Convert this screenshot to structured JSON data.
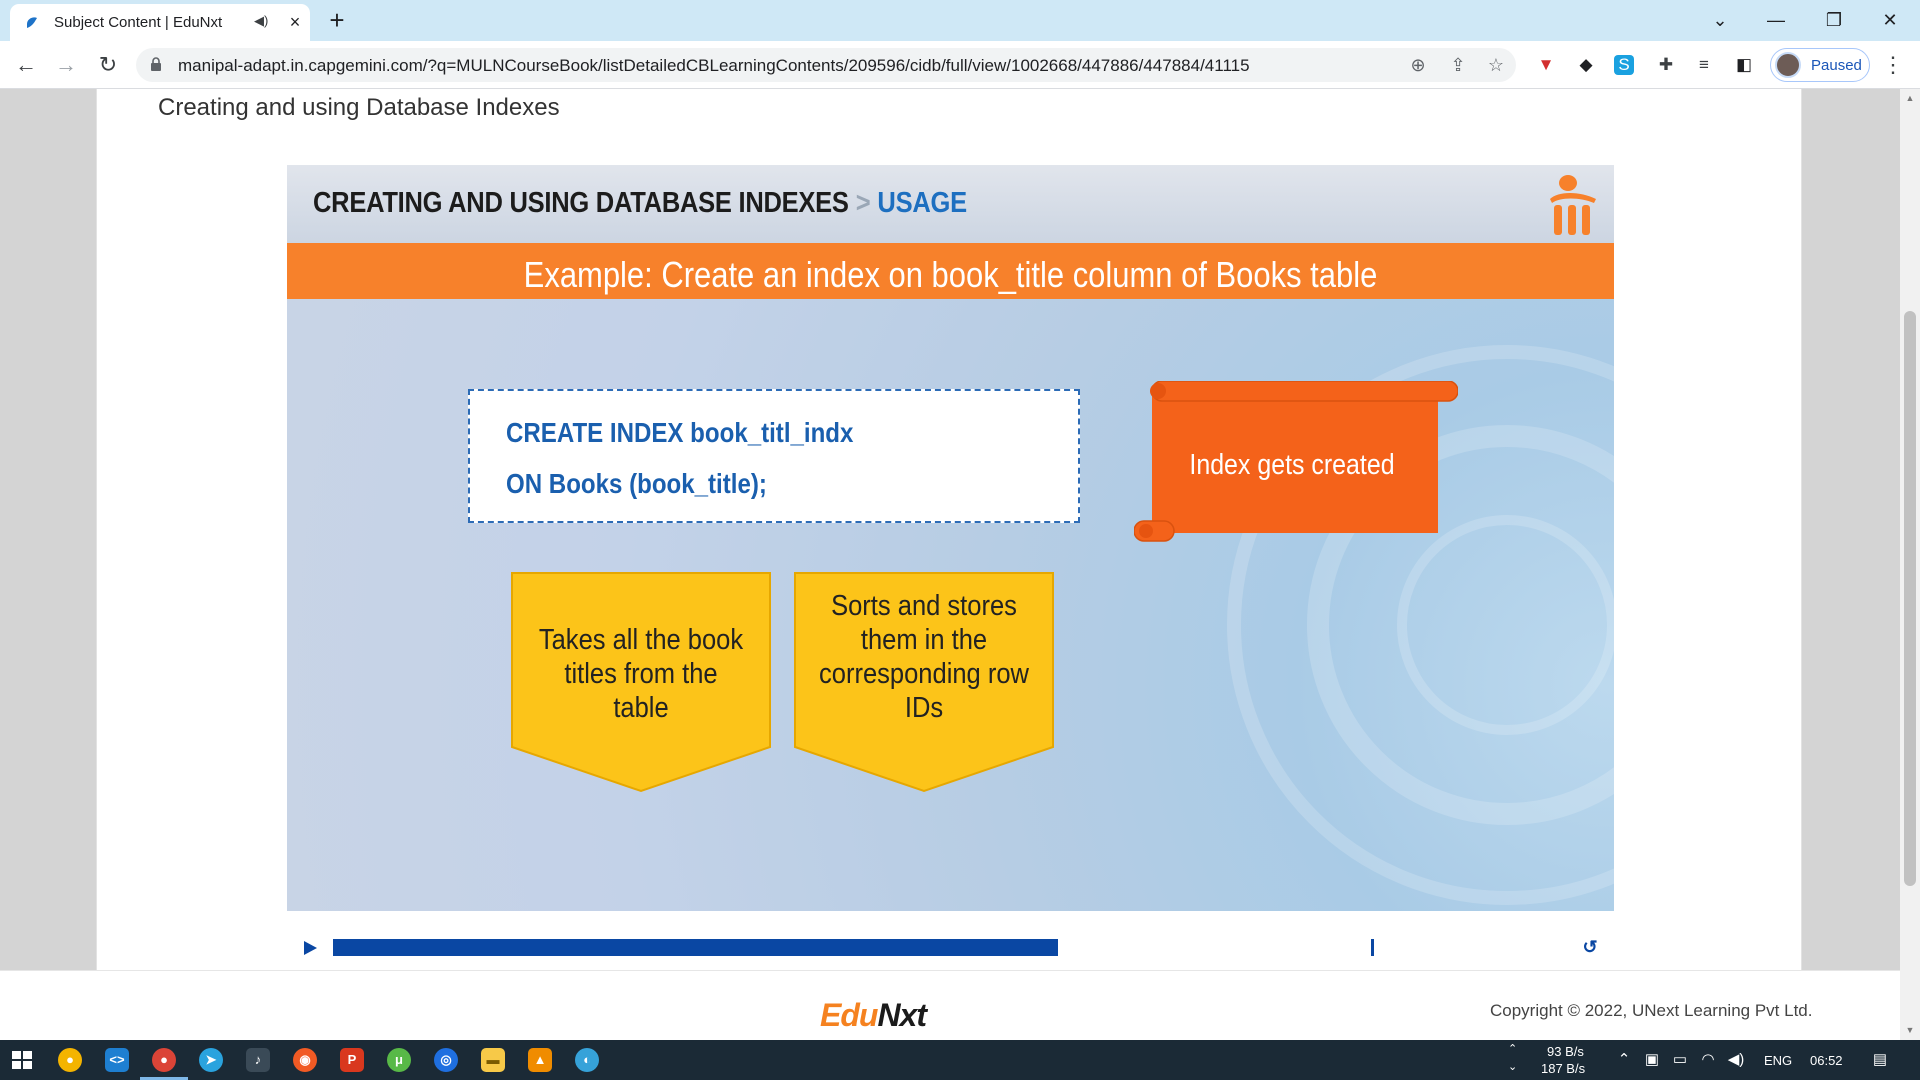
{
  "browser": {
    "tab_title": "Subject Content | EduNxt",
    "new_tab": "+",
    "url": "manipal-adapt.in.capgemini.com/?q=MULNCourseBook/listDetailedCBLearningContents/209596/cidb/full/view/1002668/447886/447884/41115",
    "profile_status": "Paused",
    "window_controls": {
      "tab_search": "⌄",
      "minimize": "—",
      "restore": "❐",
      "close": "✕"
    }
  },
  "content": {
    "title": "Creating and using Database Indexes"
  },
  "slide": {
    "heading_main": "CREATING AND USING DATABASE INDEXES",
    "heading_sep": ">",
    "heading_sub": "USAGE",
    "banner": "Example: Create an index on book_title column of Books table",
    "code_line_1": "CREATE INDEX book_titl_indx",
    "code_line_2": "ON Books (book_title);",
    "result_label": "Index gets created",
    "step_1": "Takes all the book titles from the table",
    "step_2": "Sorts and stores them in  the corresponding row IDs"
  },
  "player": {
    "progress_fraction": 0.58
  },
  "footer": {
    "logo_part_1": "Edu",
    "logo_part_2": "Nxt",
    "copyright": "Copyright © 2022, UNext Learning Pvt Ltd."
  },
  "taskbar": {
    "net_up": "93 B/s",
    "net_down": "187 B/s",
    "language": "ENG",
    "time": "06:52"
  },
  "colors": {
    "orange": "#f7812b",
    "blue": "#1a5fae",
    "yellow": "#fcc419",
    "scroll_orange": "#f4621a",
    "progress_blue": "#0a47a3"
  }
}
